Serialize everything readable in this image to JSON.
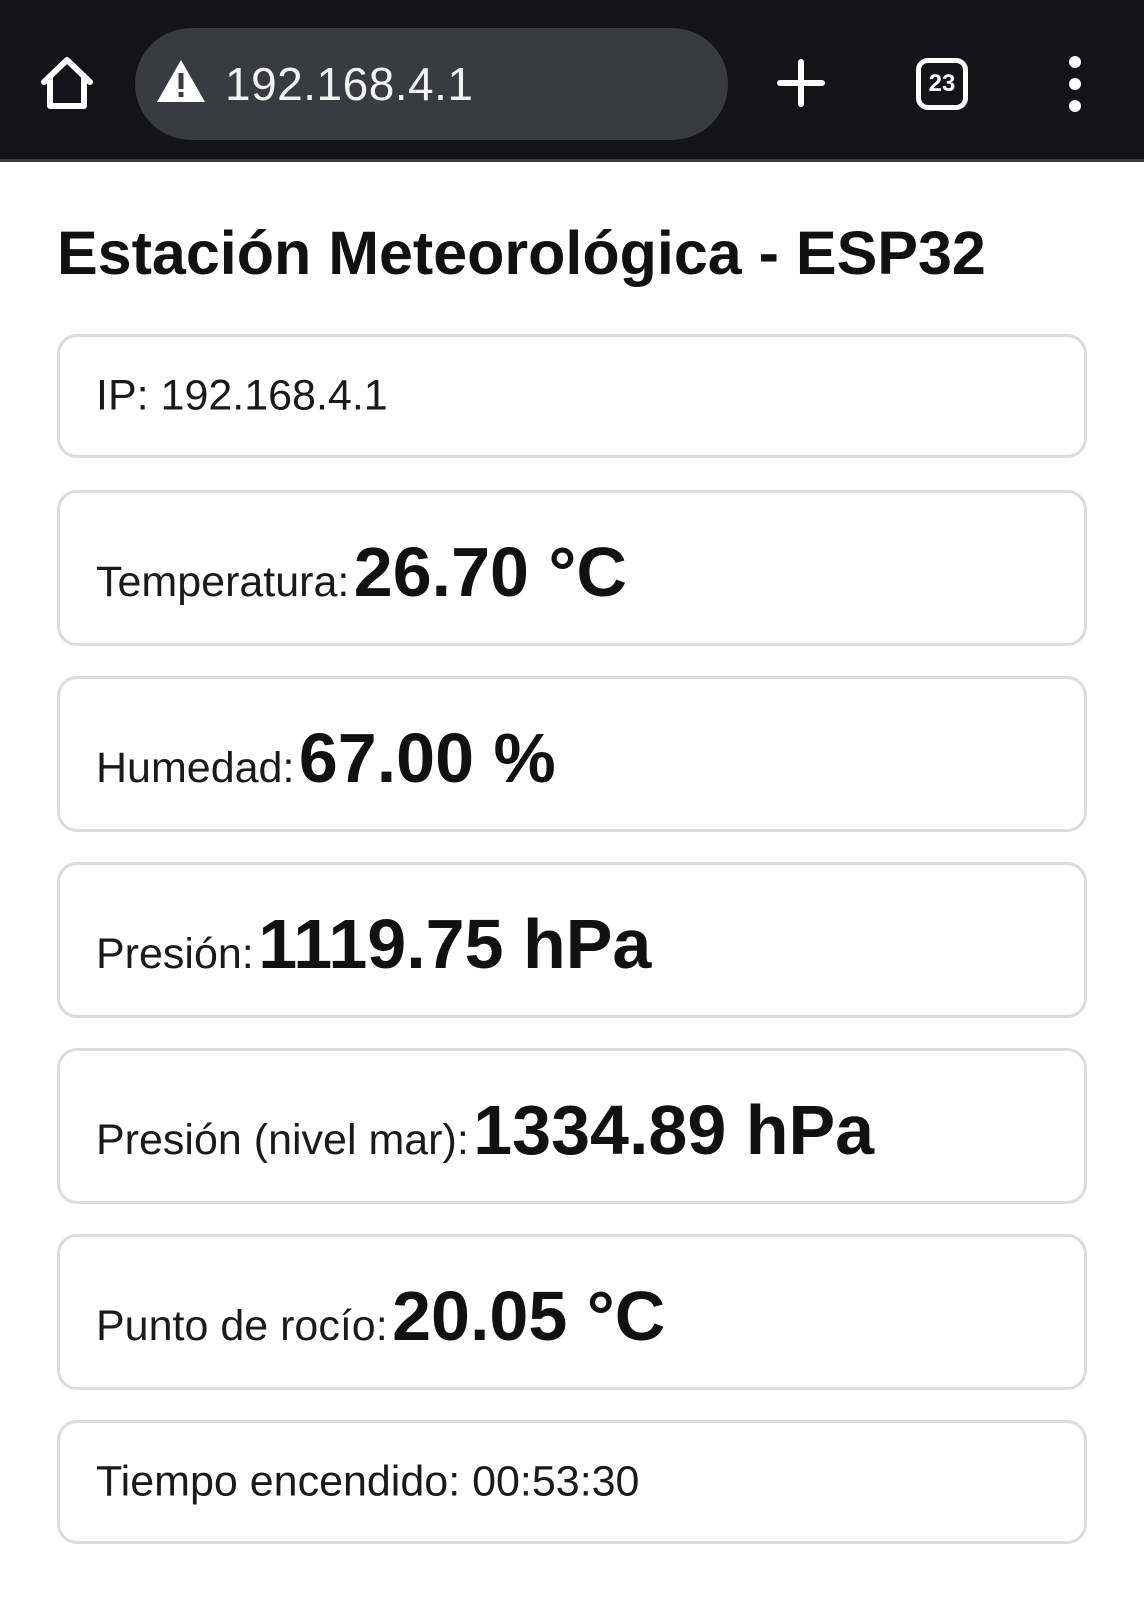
{
  "browser": {
    "url": "192.168.4.1",
    "tab_count": "23"
  },
  "page": {
    "title": "Estación Meteorológica - ESP32"
  },
  "cards": {
    "ip": {
      "label": "IP:",
      "value": "192.168.4.1"
    },
    "temperature": {
      "label": "Temperatura:",
      "value": "26.70 °C"
    },
    "humidity": {
      "label": "Humedad:",
      "value": "67.00 %"
    },
    "pressure": {
      "label": "Presión:",
      "value": "1119.75 hPa"
    },
    "pressure_sea": {
      "label": "Presión (nivel mar):",
      "value": "1334.89 hPa"
    },
    "dew_point": {
      "label": "Punto de rocío:",
      "value": "20.05 °C"
    },
    "uptime": {
      "label": "Tiempo encendido:",
      "value": "00:53:30"
    }
  },
  "icons": {
    "home": "home-icon",
    "warning": "warning-icon",
    "new_tab": "plus-icon",
    "tabs": "tab-switcher-icon",
    "menu": "more-vertical-icon"
  }
}
